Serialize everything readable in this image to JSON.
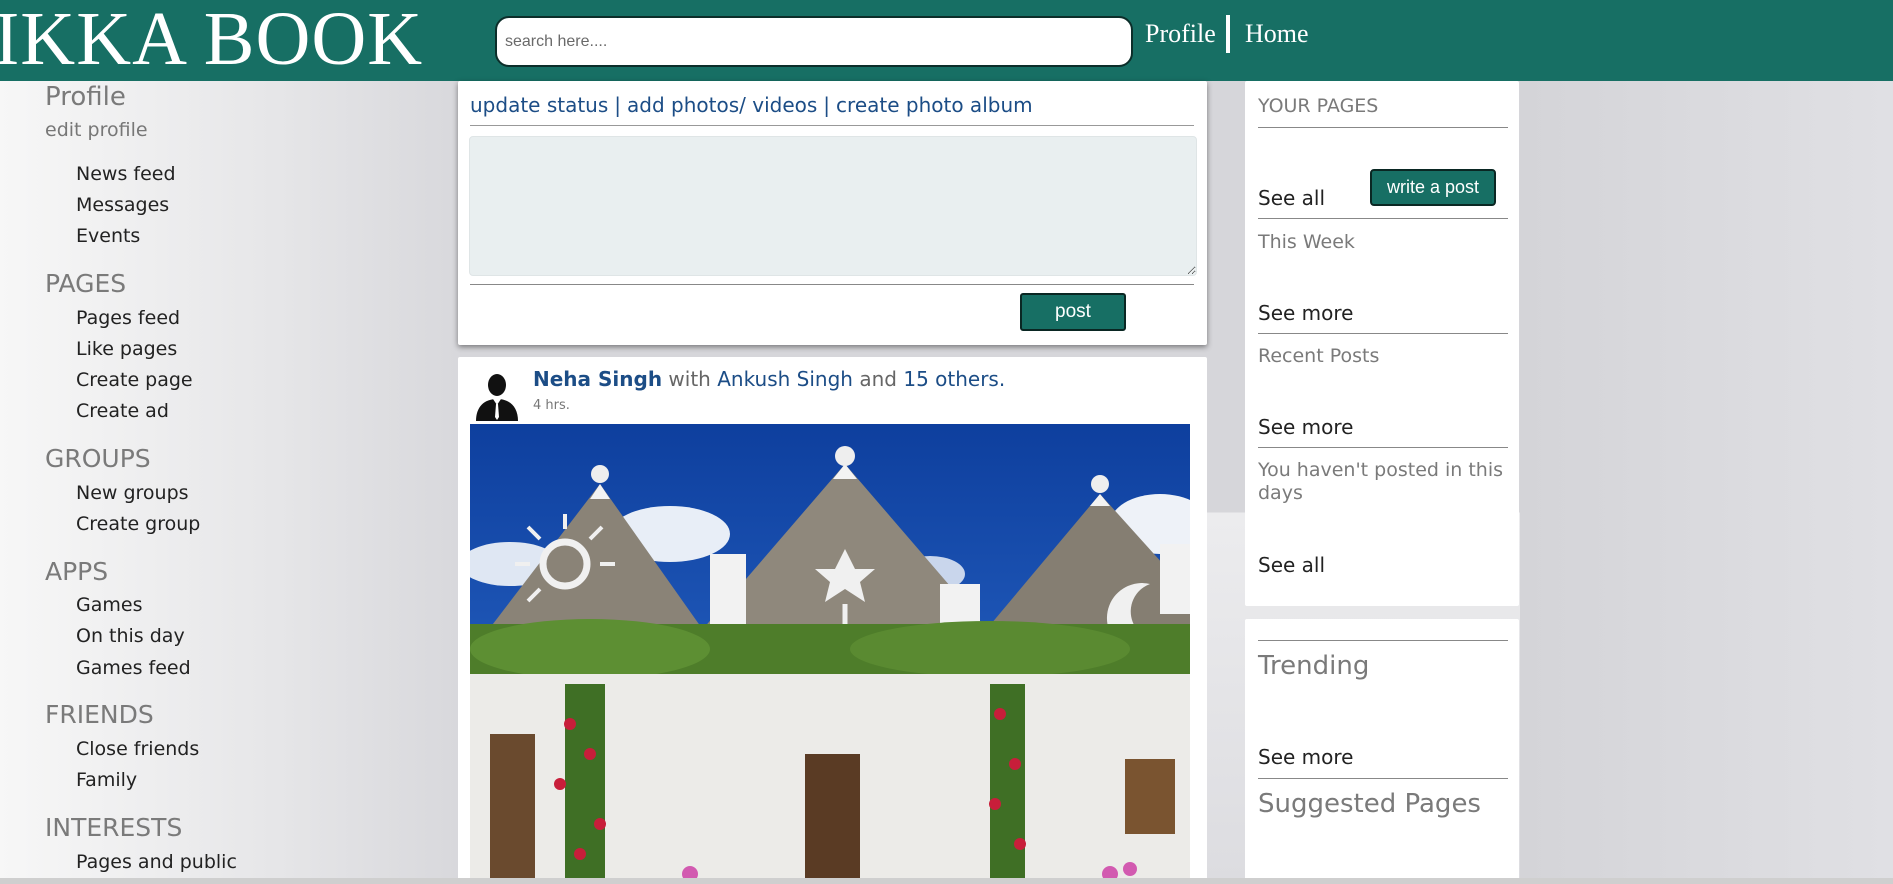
{
  "header": {
    "logo": "IKKA BOOK",
    "search_placeholder": "search here....",
    "nav_profile": "Profile",
    "nav_home": "Home"
  },
  "sidebar": {
    "profile_heading": "Profile",
    "edit_profile": "edit profile",
    "top_items": [
      "News feed",
      "Messages",
      "Events"
    ],
    "sections": [
      {
        "heading": "PAGES",
        "items": [
          "Pages feed",
          "Like pages",
          "Create page",
          "Create ad"
        ]
      },
      {
        "heading": "GROUPS",
        "items": [
          "New groups",
          "Create group"
        ]
      },
      {
        "heading": "APPS",
        "items": [
          "Games",
          "On this day",
          "Games feed"
        ]
      },
      {
        "heading": "FRIENDS",
        "items": [
          "Close friends",
          "Family"
        ]
      },
      {
        "heading": "INTERESTS",
        "items": [
          "Pages and public"
        ]
      }
    ]
  },
  "composer": {
    "tab_update_status": "update status",
    "tab_add_photos": "add photos/ videos",
    "tab_create_album": "create photo album",
    "separator": "|",
    "post_button": "post"
  },
  "post": {
    "author": "Neha Singh",
    "with_text": "with",
    "tagged": "Ankush Singh",
    "and_text": "and",
    "others": "15 others.",
    "time": "4 hrs."
  },
  "right_panel": {
    "your_pages": "YOUR PAGES",
    "see_all_1": "See all",
    "write_post_button": "write a post",
    "this_week": "This Week",
    "see_more_1": "See more",
    "recent_posts": "Recent Posts",
    "see_more_2": "See more",
    "not_posted": "You haven't posted in this days",
    "see_all_2": "See all",
    "trending": "Trending",
    "see_more_3": "See more",
    "suggested_pages": "Suggested Pages"
  },
  "colors": {
    "brand": "#176f64",
    "link": "#1c4d86",
    "muted": "#7a7a7a"
  }
}
